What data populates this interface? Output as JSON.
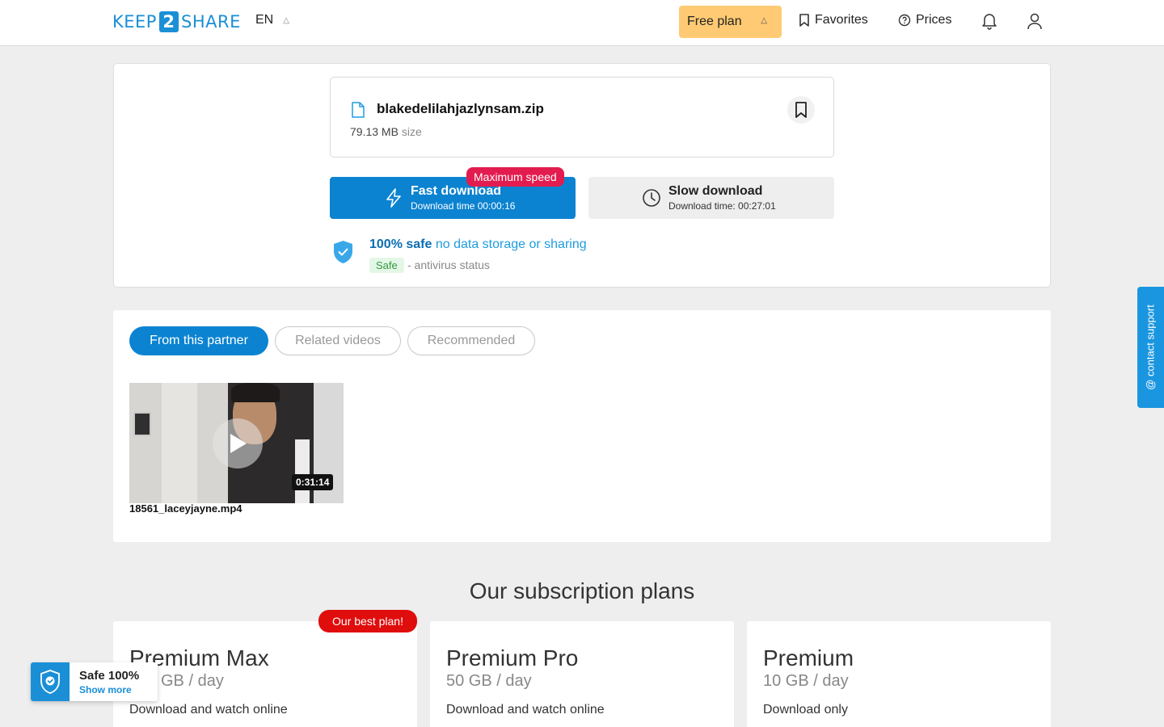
{
  "header": {
    "logo_left": "KEEP",
    "logo_num": "2",
    "logo_right": "SHARE",
    "lang": "EN",
    "plan_label": "Free plan",
    "favorites": "Favorites",
    "prices": "Prices"
  },
  "file": {
    "name": "blakedelilahjazlynsam.zip",
    "size": "79.13 MB",
    "size_unit": "size"
  },
  "download": {
    "fast_title": "Fast download",
    "fast_time": "Download time 00:00:16",
    "max_badge": "Maximum speed",
    "slow_title": "Slow download",
    "slow_time": "Download time: 00:27:01"
  },
  "safety": {
    "bold": "100% safe",
    "rest": " no data storage or sharing",
    "badge": "Safe",
    "antivirus": "- antivirus status"
  },
  "tabs": [
    {
      "label": "From this partner",
      "active": true
    },
    {
      "label": "Related videos",
      "active": false
    },
    {
      "label": "Recommended",
      "active": false
    }
  ],
  "videos": [
    {
      "title": "18561_laceyjayne.mp4",
      "duration": "0:31:14"
    }
  ],
  "plans": {
    "title": "Our subscription plans",
    "best_badge": "Our best plan!",
    "items": [
      {
        "name": "Premium Max",
        "quota": "GB / day",
        "desc": "Download and watch online"
      },
      {
        "name": "Premium Pro",
        "quota": "50 GB / day",
        "desc": "Download and watch online"
      },
      {
        "name": "Premium",
        "quota": "10 GB / day",
        "desc": "Download only"
      }
    ]
  },
  "support": "@ contact support",
  "safe_widget": {
    "title": "Safe 100%",
    "link": "Show more"
  },
  "colors": {
    "accent": "#0b83d1",
    "plan_yellow": "#ffca73",
    "badge_red": "#e31c4f",
    "best_red": "#e00d0d"
  }
}
